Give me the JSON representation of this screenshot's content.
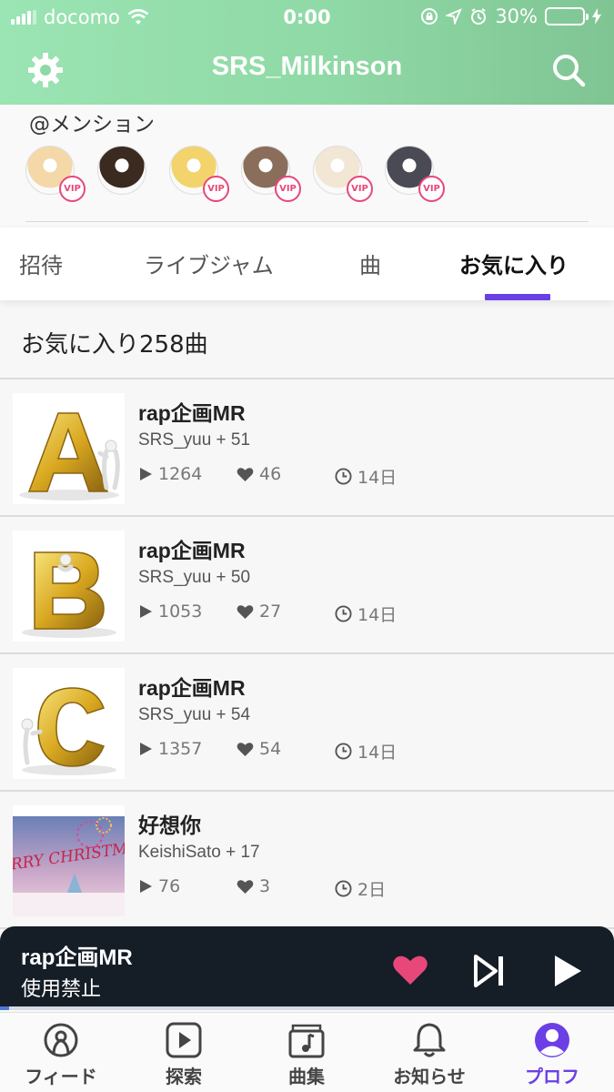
{
  "status_bar": {
    "carrier": "docomo",
    "time": "0:00",
    "battery": "30%",
    "battery_level": 0.3
  },
  "nav": {
    "title": "SRS_Milkinson",
    "settings_icon": "gear-icon",
    "search_icon": "search-icon"
  },
  "mentions": {
    "label": "@メンション",
    "users": [
      {
        "vip": "VIP",
        "color": "#f4d8a8"
      },
      {
        "vip": "",
        "color": "#3a2a20"
      },
      {
        "vip": "VIP",
        "color": "#f3d36b"
      },
      {
        "vip": "VIP",
        "color": "#8a6d5a"
      },
      {
        "vip": "VIP",
        "color": "#f2e6d4"
      },
      {
        "vip": "VIP",
        "color": "#4a4a55"
      }
    ]
  },
  "tabs": [
    "招待",
    "ライブジャム",
    "曲",
    "お気に入り"
  ],
  "favorites": {
    "count_label": "お気に入り258曲"
  },
  "songs": [
    {
      "title": "rap企画MR",
      "artist": "SRS_yuu + 51",
      "plays": "1264",
      "likes": "46",
      "age": "14日",
      "letter": "A"
    },
    {
      "title": "rap企画MR",
      "artist": "SRS_yuu + 50",
      "plays": "1053",
      "likes": "27",
      "age": "14日",
      "letter": "B"
    },
    {
      "title": "rap企画MR",
      "artist": "SRS_yuu + 54",
      "plays": "1357",
      "likes": "54",
      "age": "14日",
      "letter": "C"
    },
    {
      "title": "好想你",
      "artist": "KeishiSato + 17",
      "plays": "76",
      "likes": "3",
      "age": "2日",
      "letter": "MERRY CHRISTMAS"
    }
  ],
  "player": {
    "title": "rap企画MR",
    "subtitle": "使用禁止",
    "progress": 0.015
  },
  "tabbar": [
    {
      "label": "フィード",
      "icon": "feed-icon"
    },
    {
      "label": "探索",
      "icon": "explore-play-icon"
    },
    {
      "label": "曲集",
      "icon": "songbook-icon"
    },
    {
      "label": "お知らせ",
      "icon": "bell-icon"
    },
    {
      "label": "プロフ",
      "icon": "profile-icon"
    }
  ],
  "colors": {
    "header_green": "#8fd9a6",
    "accent_purple": "#6b3fe6",
    "heart_pink": "#e8477a",
    "player_bg": "#151d26"
  }
}
